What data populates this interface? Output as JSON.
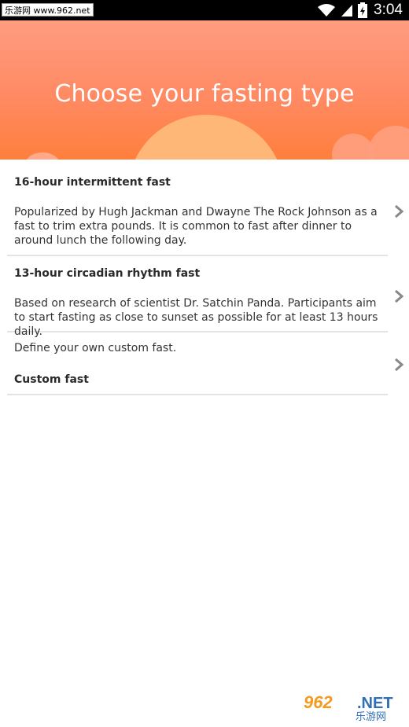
{
  "status_bar": {
    "watermark": "乐游网 www.962.net",
    "time": "3:04"
  },
  "header": {
    "title": "Choose your fasting type"
  },
  "fasting_types": [
    {
      "title": "16-hour intermittent fast",
      "description": "Popularized by Hugh Jackman and Dwayne The Rock Johnson as a fast to trim extra pounds. It is common to fast after dinner to around lunch the following day."
    },
    {
      "title": "13-hour circadian rhythm fast",
      "description": "Based on research of scientist Dr. Satchin Panda. Participants aim to start fasting as close to sunset as possible for at least 13 hours daily."
    },
    {
      "title": "Custom fast",
      "description": "Define your own custom fast."
    }
  ],
  "footer_watermark": {
    "number": "962",
    "suffix": ".NET",
    "name": "乐游网"
  },
  "colors": {
    "header_top": "#ff9c80",
    "header_bottom": "#ff7f3c",
    "sun": "#ffb777",
    "divider": "#e4e4e4",
    "chevron": "#888888"
  },
  "icons": [
    "wifi-icon",
    "signal-icon",
    "battery-icon",
    "chevron-right-icon"
  ]
}
